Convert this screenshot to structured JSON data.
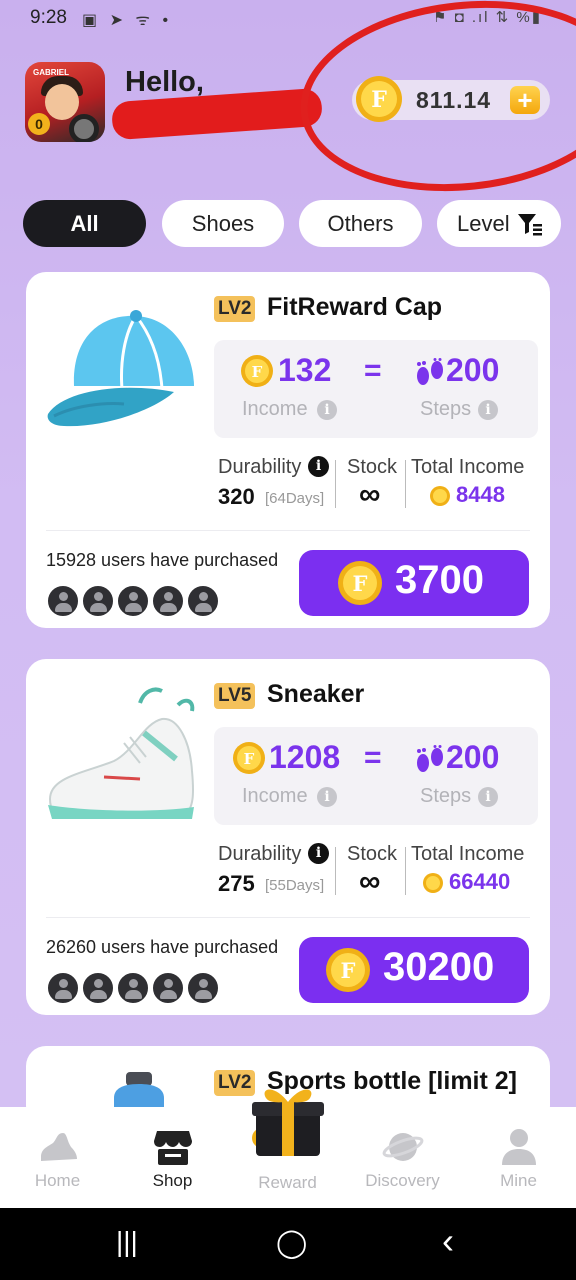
{
  "status_bar": {
    "time": "9:28",
    "left_icons": "▣ ➤ ᯤ •",
    "right_icons": "⚑ ◘ .ıl ⇅ %▮"
  },
  "header": {
    "greeting": "Hello,",
    "avatar_badge": "0",
    "avatar_tag": "GABRIEL",
    "balance": "811.14",
    "add_symbol": "+"
  },
  "filters": {
    "tabs": [
      "All",
      "Shoes",
      "Others",
      "Level"
    ]
  },
  "products": [
    {
      "level": "LV2",
      "name": "FitReward Cap",
      "income": "132",
      "equals": "=",
      "steps": "200",
      "income_label": "Income",
      "steps_label": "Steps",
      "info_symbol": "i",
      "durability_label": "Durability",
      "durability": "320",
      "durability_days": "[64Days]",
      "stock_label": "Stock",
      "stock": "∞",
      "total_income_label": "Total Income",
      "total_income": "8448",
      "purchased_text": "15928 users have purchased",
      "price": "3700"
    },
    {
      "level": "LV5",
      "name": "Sneaker",
      "income": "1208",
      "equals": "=",
      "steps": "200",
      "income_label": "Income",
      "steps_label": "Steps",
      "info_symbol": "i",
      "durability_label": "Durability",
      "durability": "275",
      "durability_days": "[55Days]",
      "stock_label": "Stock",
      "stock": "∞",
      "total_income_label": "Total Income",
      "total_income": "66440",
      "purchased_text": "26260 users have purchased",
      "price": "30200"
    },
    {
      "level": "LV2",
      "name": "Sports bottle [limit 2]"
    }
  ],
  "bottom_nav": {
    "items": [
      "Home",
      "Shop",
      "Reward",
      "Discovery",
      "Mine"
    ],
    "active": "Shop"
  },
  "system_nav": {
    "recents": "|||",
    "home": "◯",
    "back": "‹"
  },
  "colors": {
    "accent": "#7b2ff0",
    "background": "#d2bcf3",
    "annotation_red": "#e0201e",
    "coin_gold": "#f7c325"
  }
}
